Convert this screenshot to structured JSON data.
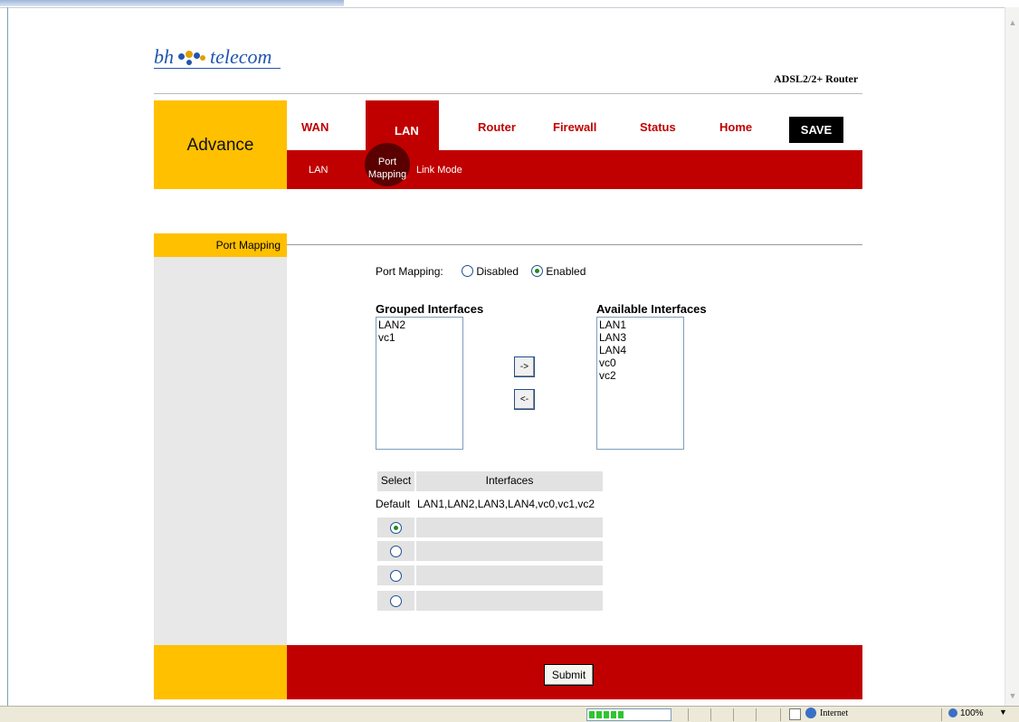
{
  "brand": {
    "logo_left": "bh",
    "logo_right": "telecom",
    "product": "ADSL2/2+ Router"
  },
  "colors": {
    "accent_red": "#c00000",
    "accent_yellow": "#ffc000",
    "logo_blue": "#2255b0"
  },
  "nav": {
    "section": "Advance",
    "tabs": [
      "WAN",
      "LAN",
      "Router",
      "Firewall",
      "Status",
      "Home"
    ],
    "active_tab": "LAN",
    "save_label": "SAVE",
    "subtabs": [
      "LAN",
      "Port Mapping",
      "Link Mode"
    ],
    "active_subtab": "Port Mapping"
  },
  "section": {
    "title": "Port Mapping"
  },
  "port_mapping": {
    "label": "Port Mapping:",
    "options": [
      "Disabled",
      "Enabled"
    ],
    "selected": "Enabled"
  },
  "grouped": {
    "label": "Grouped Interfaces",
    "items": [
      "LAN2",
      "vc1"
    ]
  },
  "available": {
    "label": "Available Interfaces",
    "items": [
      "LAN1",
      "LAN3",
      "LAN4",
      "vc0",
      "vc2"
    ]
  },
  "move": {
    "right": "->",
    "left": "<-"
  },
  "groups_table": {
    "headers": [
      "Select",
      "Interfaces"
    ],
    "default_label": "Default",
    "default_interfaces": "LAN1,LAN2,LAN3,LAN4,vc0,vc1,vc2",
    "rows": [
      {
        "selected": true,
        "interfaces": ""
      },
      {
        "selected": false,
        "interfaces": ""
      },
      {
        "selected": false,
        "interfaces": ""
      },
      {
        "selected": false,
        "interfaces": ""
      }
    ]
  },
  "submit_label": "Submit",
  "status_bar": {
    "zone": "Internet",
    "zoom": "100%"
  }
}
